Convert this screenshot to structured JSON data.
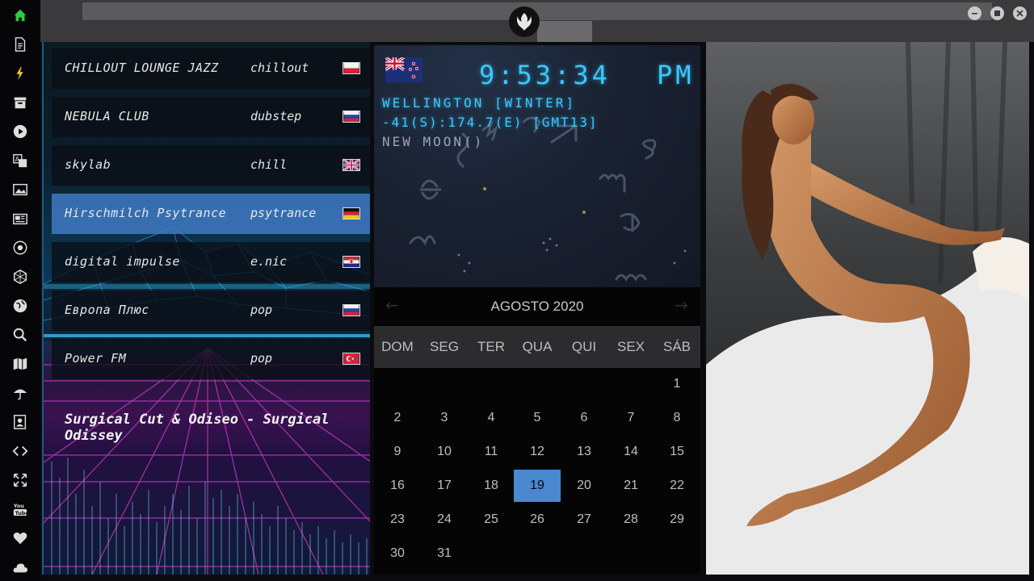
{
  "sidebar": {
    "icons": [
      "home-icon",
      "document-icon",
      "bolt-icon",
      "archive-icon",
      "play-icon",
      "translate-icon",
      "image-icon",
      "news-icon",
      "aperture-icon",
      "hexagon-icon",
      "globe-icon",
      "search-icon",
      "map-icon",
      "umbrella-icon",
      "contact-icon",
      "code-icon",
      "fullscreen-icon",
      "youtube-icon",
      "heart-icon",
      "cloud-icon"
    ],
    "accent": "#2ecc40"
  },
  "radio": {
    "stations": [
      {
        "name": "CHILLOUT LOUNGE JAZZ",
        "genre": "chillout",
        "flag": "poland"
      },
      {
        "name": "NEBULA CLUB",
        "genre": "dubstep",
        "flag": "russia"
      },
      {
        "name": "skylab",
        "genre": "chill",
        "flag": "uk"
      },
      {
        "name": "Hirschmilch Psytrance",
        "genre": "psytrance",
        "flag": "germany"
      },
      {
        "name": "digital impulse",
        "genre": "e.nic",
        "flag": "croatia"
      },
      {
        "name": "Европа Плюс",
        "genre": "pop",
        "flag": "russia"
      },
      {
        "name": "Power FM",
        "genre": "pop",
        "flag": "turkey"
      }
    ],
    "now_playing": "Surgical Cut & Odiseo - Surgical Odissey",
    "active_index": 3
  },
  "clock": {
    "time": "9:53:34",
    "ampm": "PM",
    "city": "WELLINGTON [WINTER]",
    "coords": "-41(S):174.7(E) [GMT13]",
    "moon": "NEW MOON()",
    "digit_color": "#39c9ff"
  },
  "calendar": {
    "title": "AGOSTO 2020",
    "prev": "←",
    "next": "→",
    "weekdays": [
      "DOM",
      "SEG",
      "TER",
      "QUA",
      "QUI",
      "SEX",
      "SÁB"
    ],
    "days": [
      [
        "",
        "",
        "",
        "",
        "",
        "",
        "1"
      ],
      [
        "2",
        "3",
        "4",
        "5",
        "6",
        "7",
        "8"
      ],
      [
        "9",
        "10",
        "11",
        "12",
        "13",
        "14",
        "15"
      ],
      [
        "16",
        "17",
        "18",
        "19",
        "20",
        "21",
        "22"
      ],
      [
        "23",
        "24",
        "25",
        "26",
        "27",
        "28",
        "29"
      ],
      [
        "30",
        "31",
        "",
        "",
        "",
        "",
        ""
      ]
    ],
    "today": "19",
    "highlight_color": "#4a88d0"
  }
}
